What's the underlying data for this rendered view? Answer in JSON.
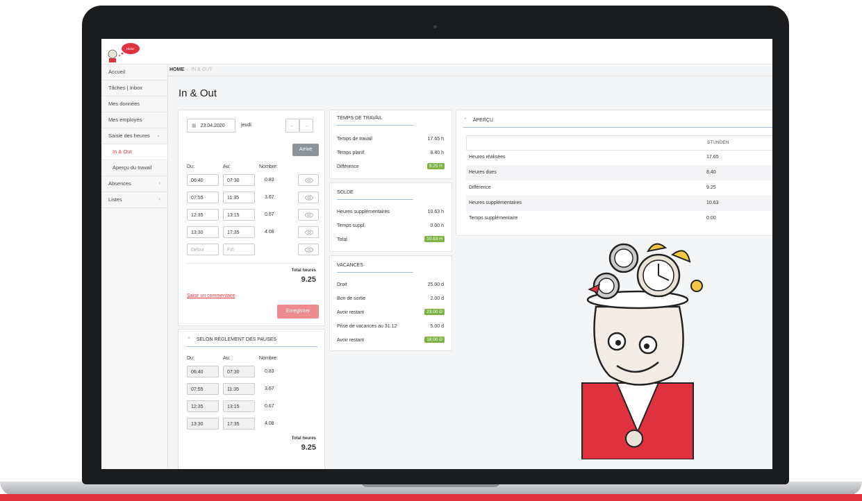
{
  "sidebar": {
    "items": [
      {
        "label": "Accueil"
      },
      {
        "label": "Tâches | Inbox"
      },
      {
        "label": "Mes données"
      },
      {
        "label": "Mes employés"
      },
      {
        "label": "Saisie des heures"
      },
      {
        "label": "In & Out"
      },
      {
        "label": "Aperçu du travail"
      },
      {
        "label": "Absences"
      },
      {
        "label": "Listes"
      }
    ]
  },
  "breadcrumb": {
    "home": "HOME",
    "current": "IN & OUT"
  },
  "page": {
    "title": "In & Out"
  },
  "entry": {
    "date": "23.04.2020",
    "weekday": "jeudi",
    "arrive_label": "Arrive",
    "col_from": "Du:",
    "col_to": "Au:",
    "col_count": "Nombre:",
    "rows": [
      {
        "from": "06:40",
        "to": "07:30",
        "count": "0.83"
      },
      {
        "from": "07:55",
        "to": "11:35",
        "count": "3.67"
      },
      {
        "from": "12:35",
        "to": "13:15",
        "count": "0.67"
      },
      {
        "from": "13:30",
        "to": "17:35",
        "count": "4.08"
      }
    ],
    "start_placeholder": "Début",
    "end_placeholder": "Fin",
    "total_label": "Total heures",
    "total_value": "9.25",
    "comment_link": "Saisir un commentaire",
    "save_label": "Enregistrer"
  },
  "pauses": {
    "title": "SELON RÈGLEMENT DES PAUSES",
    "col_from": "Du:",
    "col_to": "Au:",
    "col_count": "Nombre:",
    "rows": [
      {
        "from": "06:40",
        "to": "07:30",
        "count": "0.83"
      },
      {
        "from": "07:55",
        "to": "11:35",
        "count": "3.67"
      },
      {
        "from": "12:35",
        "to": "13:15",
        "count": "0.67"
      },
      {
        "from": "13:30",
        "to": "17:35",
        "count": "4.08"
      }
    ],
    "total_label": "Total heures",
    "total_value": "9.25"
  },
  "temps": {
    "title": "TEMPS DE TRAVAIL",
    "rows": [
      {
        "label": "Temps de travail",
        "value": "17.65 h"
      },
      {
        "label": "Temps planif.",
        "value": "8.40 h"
      },
      {
        "label": "Différence",
        "value": "9.25 H"
      }
    ]
  },
  "solde": {
    "title": "SOLDE",
    "rows": [
      {
        "label": "Heures supplémentaires",
        "value": "10.63 h"
      },
      {
        "label": "Temps suppl.",
        "value": "0.00 h"
      },
      {
        "label": "Total",
        "value": "10.63 H"
      }
    ]
  },
  "vacances": {
    "title": "VACANCES",
    "rows": [
      {
        "label": "Droit",
        "value": "25.00 d"
      },
      {
        "label": "Bon de sortie",
        "value": "2.00 d"
      },
      {
        "label": "Avoir restant",
        "value": "23.00 D"
      },
      {
        "label": "Prise de vacances au 31.12",
        "value": "5.00 d"
      },
      {
        "label": "Avoir restant",
        "value": "18.00 D"
      }
    ]
  },
  "apercu": {
    "title": "APERÇU",
    "column": "STUNDEN",
    "rows": [
      {
        "label": "Heures réalisées",
        "value": "17.65"
      },
      {
        "label": "Heures dues",
        "value": "8.40"
      },
      {
        "label": "Différence",
        "value": "9.25"
      },
      {
        "label": "Heures supplémentaires",
        "value": "10.63"
      },
      {
        "label": "Temps supplémentaire",
        "value": "0.00"
      }
    ]
  },
  "colors": {
    "accent": "#e0323e",
    "badge": "#7cb342",
    "rule": "#9fb9d6"
  }
}
